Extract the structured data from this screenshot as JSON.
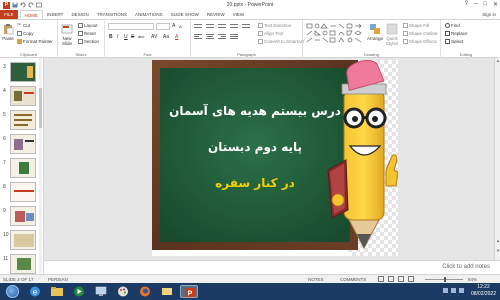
{
  "window": {
    "title": "20.pptx - PowerPoint",
    "app_badge": "P",
    "controls": [
      "?",
      "–",
      "□",
      "✕"
    ]
  },
  "tabs": [
    {
      "label": "FILE"
    },
    {
      "label": "HOME"
    },
    {
      "label": "INSERT"
    },
    {
      "label": "DESIGN"
    },
    {
      "label": "TRANSITIONS"
    },
    {
      "label": "ANIMATIONS"
    },
    {
      "label": "SLIDE SHOW"
    },
    {
      "label": "REVIEW"
    },
    {
      "label": "VIEW"
    }
  ],
  "sign_in": "Sign in",
  "ribbon": {
    "clipboard": {
      "label": "Clipboard",
      "paste": "Paste",
      "cut": "Cut",
      "copy": "Copy",
      "format_painter": "Format Painter"
    },
    "slides": {
      "label": "Slides",
      "new_slide": "New Slide",
      "layout": "Layout",
      "reset": "Reset",
      "section": "Section"
    },
    "font": {
      "label": "Font",
      "bold": "B",
      "italic": "I",
      "underline": "U",
      "strike": "S",
      "shadow": "abc"
    },
    "paragraph": {
      "label": "Paragraph",
      "text_direction": "Text Direction",
      "align_text": "Align Text",
      "convert_smartart": "Convert to SmartArt"
    },
    "drawing": {
      "label": "Drawing",
      "arrange": "Arrange",
      "quick_styles": "Quick Styles",
      "shape_fill": "Shape Fill",
      "shape_outline": "Shape Outline",
      "shape_effects": "Shape Effects"
    },
    "editing": {
      "label": "Editing",
      "find": "Find",
      "replace": "Replace",
      "select": "Select"
    }
  },
  "thumbnails": [
    {
      "num": "3"
    },
    {
      "num": "4"
    },
    {
      "num": "5"
    },
    {
      "num": "6"
    },
    {
      "num": "7"
    },
    {
      "num": "8"
    },
    {
      "num": "9"
    },
    {
      "num": "10"
    },
    {
      "num": "11"
    }
  ],
  "slide": {
    "line1": "درس بیستم هدیه های آسمان",
    "line2": "پایه دوم دبستان",
    "line3": "در کنار سفره"
  },
  "notes_placeholder": "Click to add notes",
  "status": {
    "slide_counter": "SLIDE 2 OF 17",
    "language": "PERSIAN",
    "notes": "NOTES",
    "comments": "COMMENTS",
    "zoom": "84%"
  },
  "taskbar": {
    "time": "12:22",
    "date": "08/02/2022"
  },
  "colors": {
    "accent": "#c43e1c",
    "chalkboard": "#1f5a35",
    "slide_text_white": "#ffffff",
    "slide_text_yellow": "#f5d000",
    "taskbar": "#1c3b64"
  }
}
